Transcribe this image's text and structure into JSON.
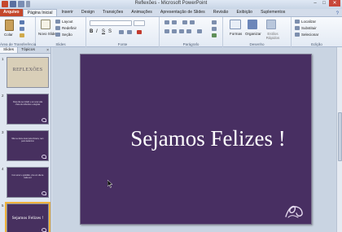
{
  "window": {
    "title": "Reflexões - Microsoft PowerPoint",
    "minimize": "–",
    "maximize": "□",
    "close": "✕"
  },
  "tabs": [
    {
      "label": "Arquivo"
    },
    {
      "label": "Página Inicial"
    },
    {
      "label": "Inserir"
    },
    {
      "label": "Design"
    },
    {
      "label": "Transições"
    },
    {
      "label": "Animações"
    },
    {
      "label": "Apresentação de Slides"
    },
    {
      "label": "Revisão"
    },
    {
      "label": "Exibição"
    },
    {
      "label": "Suplementos"
    }
  ],
  "ribbon": {
    "clipboard": {
      "paste": "Colar",
      "label": "Área de Transferência"
    },
    "slides": {
      "new_slide": "Novo Slide",
      "layout": "Layout",
      "reset": "Redefinir",
      "section": "Seção",
      "label": "Slides"
    },
    "font": {
      "label": "Fonte"
    },
    "paragraph": {
      "label": "Parágrafo"
    },
    "drawing": {
      "shapes": "Formas",
      "arrange": "Organizar",
      "quick_styles": "Estilos Rápidos",
      "label": "Desenho"
    },
    "editing": {
      "find": "Localizar",
      "replace": "Substituir",
      "select": "Selecionar",
      "label": "Edição"
    }
  },
  "pane": {
    "tab_slides": "Slides",
    "tab_outline": "Tópicos",
    "close": "×",
    "thumbnails": [
      {
        "num": "1",
        "title": "REFLEXÕES",
        "text": ""
      },
      {
        "num": "2",
        "title": "",
        "text": "Para não ser infeliz e ter uma vida cheia de reflexões e alegrias"
      },
      {
        "num": "3",
        "title": "",
        "text": "Não se deixe levar pela tristeza, nem pelo desânimo"
      },
      {
        "num": "4",
        "title": "",
        "text": "Com amor e gratidão, viva um dia de cada vez"
      },
      {
        "num": "5",
        "title": "Sejamos Felizes !",
        "text": ""
      }
    ]
  },
  "slide": {
    "title": "Sejamos Felizes !"
  }
}
